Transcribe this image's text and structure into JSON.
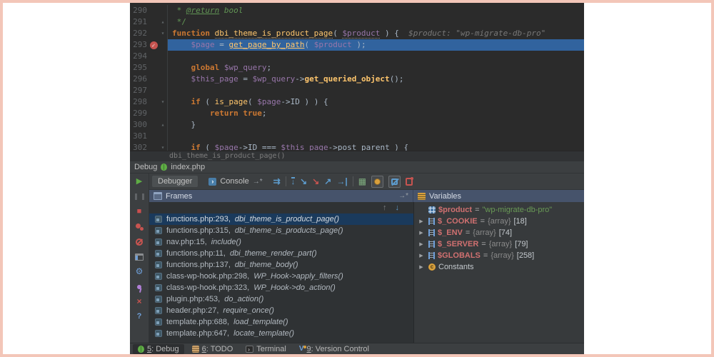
{
  "window": {
    "debug_header": {
      "title": "Debug",
      "file": "index.php"
    }
  },
  "editor": {
    "breadcrumb": "dbi_theme_is_product_page()",
    "lines": [
      {
        "num": "290",
        "tokens": [
          [
            "com",
            " * "
          ],
          [
            "doc",
            "@return"
          ],
          [
            "comi",
            " bool"
          ]
        ]
      },
      {
        "num": "291",
        "fold": "end",
        "tokens": [
          [
            "com",
            " */"
          ]
        ]
      },
      {
        "num": "292",
        "fold": "start",
        "tokens": [
          [
            "kw",
            "function "
          ],
          [
            "fnd",
            "dbi_theme_is_product_page"
          ],
          [
            "pln",
            "( "
          ],
          [
            "varu",
            "$product"
          ],
          [
            "pln",
            " ) {"
          ],
          [
            "hint",
            "  $product: \"wp-migrate-db-pro\""
          ]
        ]
      },
      {
        "num": "293",
        "exec": true,
        "bp": true,
        "tokens": [
          [
            "pln",
            "    "
          ],
          [
            "var",
            "$page"
          ],
          [
            "pln",
            " = "
          ],
          [
            "fnu",
            "get_page_by_path"
          ],
          [
            "pln",
            "( "
          ],
          [
            "var",
            "$product"
          ],
          [
            "pln",
            " );"
          ]
        ]
      },
      {
        "num": "294",
        "tokens": []
      },
      {
        "num": "295",
        "tokens": [
          [
            "pln",
            "    "
          ],
          [
            "kw",
            "global "
          ],
          [
            "var",
            "$wp_query"
          ],
          [
            "pln",
            ";"
          ]
        ]
      },
      {
        "num": "296",
        "tokens": [
          [
            "pln",
            "    "
          ],
          [
            "var",
            "$this_page"
          ],
          [
            "pln",
            " = "
          ],
          [
            "var",
            "$wp_query"
          ],
          [
            "pln",
            "->"
          ],
          [
            "fnb",
            "get_queried_object"
          ],
          [
            "pln",
            "();"
          ]
        ]
      },
      {
        "num": "297",
        "tokens": []
      },
      {
        "num": "298",
        "fold": "start",
        "tokens": [
          [
            "pln",
            "    "
          ],
          [
            "kw",
            "if"
          ],
          [
            "pln",
            " ( "
          ],
          [
            "fn",
            "is_page"
          ],
          [
            "pln",
            "( "
          ],
          [
            "var",
            "$page"
          ],
          [
            "pln",
            "->ID ) ) {"
          ]
        ]
      },
      {
        "num": "299",
        "tokens": [
          [
            "pln",
            "        "
          ],
          [
            "kw",
            "return "
          ],
          [
            "kw",
            "true"
          ],
          [
            "pln",
            ";"
          ]
        ]
      },
      {
        "num": "300",
        "fold": "end",
        "tokens": [
          [
            "pln",
            "    }"
          ]
        ]
      },
      {
        "num": "301",
        "tokens": []
      },
      {
        "num": "302",
        "fold": "start",
        "tokens": [
          [
            "pln",
            "    "
          ],
          [
            "kw",
            "if"
          ],
          [
            "pln",
            " ( "
          ],
          [
            "var",
            "$page"
          ],
          [
            "pln",
            "->ID === "
          ],
          [
            "var",
            "$this_page"
          ],
          [
            "pln",
            "->post_parent ) {"
          ]
        ]
      }
    ]
  },
  "debug_toolbar": {
    "debugger_tab": "Debugger",
    "console_tab": "Console"
  },
  "frames": {
    "title": "Frames",
    "rows": [
      {
        "file": "functions.php:293",
        "func": "dbi_theme_is_product_page()",
        "selected": true
      },
      {
        "file": "functions.php:315",
        "func": "dbi_theme_is_products_page()"
      },
      {
        "file": "nav.php:15",
        "func": "include()"
      },
      {
        "file": "functions.php:11",
        "func": "dbi_theme_render_part()"
      },
      {
        "file": "functions.php:137",
        "func": "dbi_theme_body()"
      },
      {
        "file": "class-wp-hook.php:298",
        "func": "WP_Hook->apply_filters()"
      },
      {
        "file": "class-wp-hook.php:323",
        "func": "WP_Hook->do_action()"
      },
      {
        "file": "plugin.php:453",
        "func": "do_action()"
      },
      {
        "file": "header.php:27",
        "func": "require_once()"
      },
      {
        "file": "template.php:688",
        "func": "load_template()"
      },
      {
        "file": "template.php:647",
        "func": "locate_template()"
      }
    ]
  },
  "variables": {
    "title": "Variables",
    "rows": [
      {
        "kind": "value",
        "name": "$product",
        "value": "\"wp-migrate-db-pro\""
      },
      {
        "kind": "array",
        "name": "$_COOKIE",
        "type": "{array}",
        "size": "[18]"
      },
      {
        "kind": "array",
        "name": "$_ENV",
        "type": "{array}",
        "size": "[74]"
      },
      {
        "kind": "array",
        "name": "$_SERVER",
        "type": "{array}",
        "size": "[79]"
      },
      {
        "kind": "array",
        "name": "$GLOBALS",
        "type": "{array}",
        "size": "[258]"
      },
      {
        "kind": "const",
        "name": "Constants"
      }
    ]
  },
  "statusbar": {
    "tabs": [
      {
        "num": "5",
        "label": "Debug",
        "icon": "bug",
        "active": true
      },
      {
        "num": "6",
        "label": "TODO",
        "icon": "todo",
        "active": false
      },
      {
        "num": "",
        "label": "Terminal",
        "icon": "terminal",
        "active": false
      },
      {
        "num": "9",
        "label": "Version Control",
        "icon": "vcs",
        "active": false
      }
    ]
  },
  "icons": {
    "resume": "▶",
    "stop": "■",
    "gear": "⚙",
    "close": "×",
    "help": "?",
    "console_glyph": "›",
    "jump": "→*",
    "show_exec": "⇉",
    "step_over": "↓",
    "step_into": "↘",
    "step_out": "↗",
    "run_to_cursor": "→|",
    "calc": "▦",
    "expand": "▶",
    "breakpoint_check": "✓",
    "fold_start": "▾",
    "fold_end": "▴",
    "nav_up": "↑",
    "nav_down": "↓",
    "terminal_glyph": "›",
    "vcs_glyph": "V",
    "const_glyph": "c"
  },
  "colors": {
    "frame_border": "#f3c6b8",
    "editor_bg": "#2b2b2b",
    "panel_bg": "#3c3f41",
    "execution_line": "#31639e",
    "selected_frame": "#1a3a5c",
    "header_bar": "#46536b",
    "breakpoint": "#c75450",
    "keyword": "#cc7832",
    "function": "#ffc66d",
    "variable": "#9876aa",
    "string": "#6a8759",
    "comment": "#629755",
    "var_name": "#d07070",
    "accent_blue": "#5d9cce",
    "run_green": "#5fad45"
  }
}
